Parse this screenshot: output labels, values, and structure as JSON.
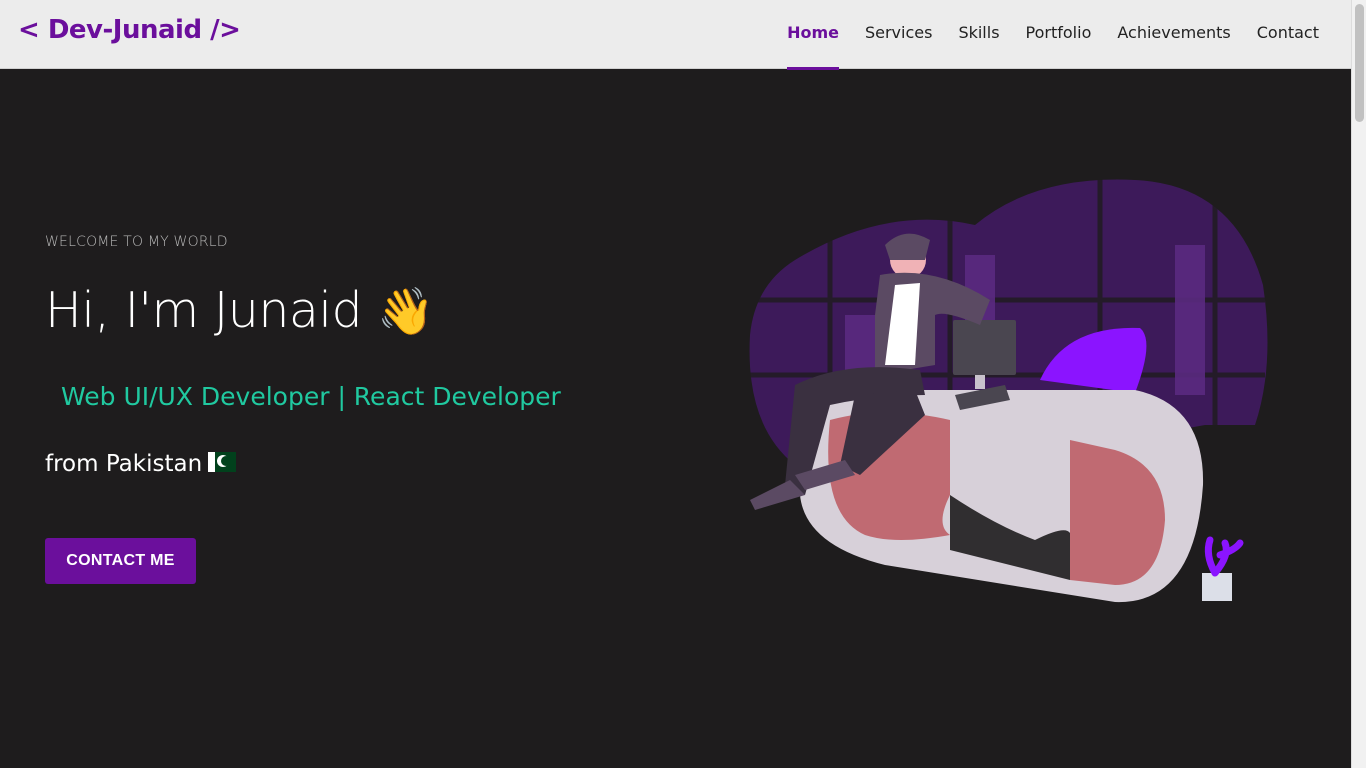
{
  "header": {
    "logo": "< Dev-Junaid />",
    "nav": [
      {
        "label": "Home",
        "active": true
      },
      {
        "label": "Services",
        "active": false
      },
      {
        "label": "Skills",
        "active": false
      },
      {
        "label": "Portfolio",
        "active": false
      },
      {
        "label": "Achievements",
        "active": false
      },
      {
        "label": "Contact",
        "active": false
      }
    ]
  },
  "hero": {
    "welcome": "WELCOME TO MY WORLD",
    "headline": "Hi, I'm Junaid",
    "wave_emoji": "👋",
    "role": "Web UI/UX Developer | React Developer",
    "from": "from Pakistan",
    "cta_label": "CONTACT ME"
  },
  "colors": {
    "brand": "#6b0f9c",
    "accent_teal": "#20c9a0",
    "background": "#1e1c1d",
    "header_bg": "#ececec"
  },
  "icons": {
    "flag": "pakistan-flag-icon",
    "wave": "waving-hand-icon"
  }
}
